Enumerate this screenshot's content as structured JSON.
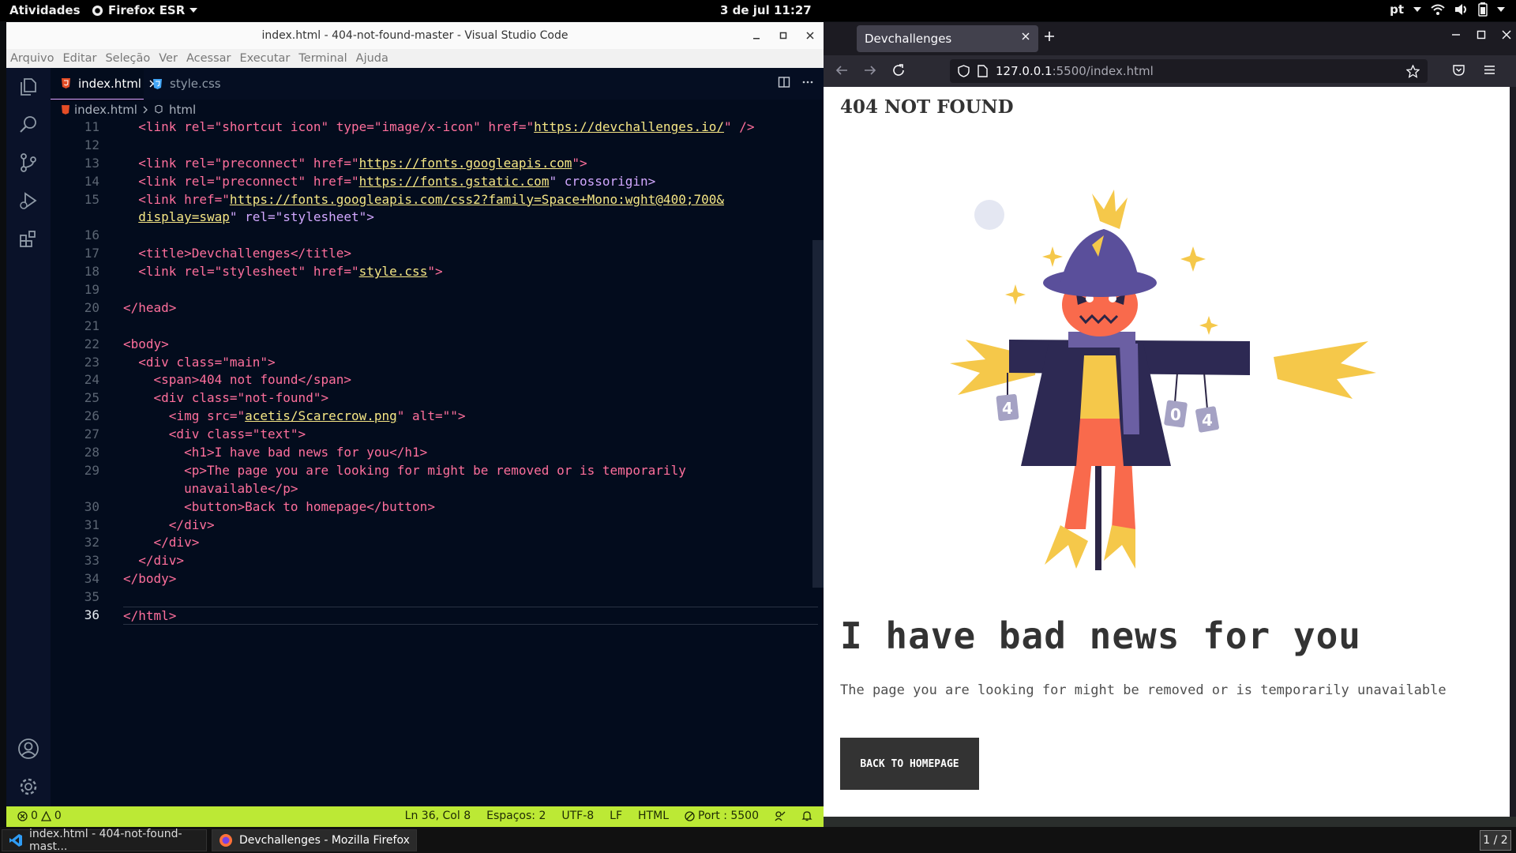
{
  "topbar": {
    "activities": "Atividades",
    "app_menu": "Firefox ESR",
    "clock": "3 de jul  11:27",
    "lang": "pt"
  },
  "vscode": {
    "title": "index.html - 404-not-found-master - Visual Studio Code",
    "menu": [
      "Arquivo",
      "Editar",
      "Seleção",
      "Ver",
      "Acessar",
      "Executar",
      "Terminal",
      "Ajuda"
    ],
    "tabs": [
      {
        "label": "index.html",
        "icon": "html5-icon",
        "active": true
      },
      {
        "label": "style.css",
        "icon": "css3-icon",
        "active": false
      }
    ],
    "breadcrumb": {
      "file": "index.html",
      "symbol": "html"
    },
    "current_line": "36",
    "line_numbers": [
      "11",
      "12",
      "13",
      "14",
      "15",
      "",
      "16",
      "17",
      "18",
      "19",
      "20",
      "21",
      "22",
      "23",
      "24",
      "25",
      "26",
      "27",
      "28",
      "29",
      "",
      "30",
      "31",
      "32",
      "33",
      "34",
      "35",
      "36"
    ],
    "code": {
      "l11a": "<link rel=\"shortcut icon\" type=\"image/x-icon\" href=\"",
      "l11b": "https://devchallenges.io/",
      "l11c": "\" />",
      "l13a": "<link rel=\"preconnect\" href=\"",
      "l13b": "https://fonts.googleapis.com",
      "l13c": "\">",
      "l14a": "<link rel=\"preconnect\" href=\"",
      "l14b": "https://fonts.gstatic.com",
      "l14c": "\" crossorigin>",
      "l15a": "<link href=\"",
      "l15b": "https://fonts.googleapis.com/css2?family=Space+Mono:wght@400;700&",
      "l15c": "display=swap",
      "l15d": "\" rel=\"stylesheet\">",
      "l17": "<title>Devchallenges</title>",
      "l18a": "<link rel=\"stylesheet\" href=\"",
      "l18b": "style.css",
      "l18c": "\">",
      "l20": "</head>",
      "l22": "<body>",
      "l23": "<div class=\"main\">",
      "l24": "<span>404 not found</span>",
      "l25": "<div class=\"not-found\">",
      "l26a": "<img src=\"",
      "l26b": "acetis/Scarecrow.png",
      "l26c": "\" alt=\"\">",
      "l27": "<div class=\"text\">",
      "l28": "<h1>I have bad news for you</h1>",
      "l29a": "<p>The page you are looking for might be removed or is temporarily",
      "l29b": "unavailable</p>",
      "l30": "<button>Back to homepage</button>",
      "l31": "</div>",
      "l32": "</div>",
      "l33": "</div>",
      "l34": "</body>",
      "l36": "</html>"
    },
    "status": {
      "errors": "0",
      "warnings": "0",
      "position": "Ln 36, Col 8",
      "spaces": "Espaços: 2",
      "encoding": "UTF-8",
      "eol": "LF",
      "language": "HTML",
      "port": "Port : 5500"
    }
  },
  "firefox": {
    "tab_title": "Devchallenges",
    "url_host": "127.0.0.1",
    "url_path": ":5500/index.html",
    "page": {
      "brand": "404 NOT FOUND",
      "heading": "I have bad news for you",
      "text": "The page you are looking for might be removed or is temporarily unavailable",
      "button": "BACK TO HOMEPAGE",
      "cans": [
        "4",
        "0",
        "4"
      ]
    }
  },
  "taskbar": {
    "tasks": [
      "index.html - 404-not-found-mast...",
      "Devchallenges - Mozilla Firefox"
    ],
    "pager": "1 / 2"
  },
  "colors": {
    "vscode_bg": "#030c1d",
    "status_accent": "#bce935",
    "tag": "#ff6f9c",
    "string": "#f6e785",
    "attribute": "#d2a8ff",
    "page_heading": "#333333"
  }
}
